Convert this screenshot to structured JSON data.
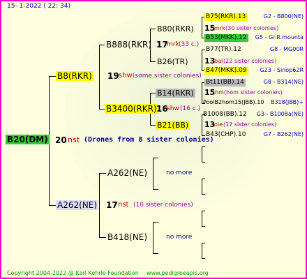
{
  "header": {
    "date": "15-  1-2022 ( 22: 34)"
  },
  "footer": {
    "copyright": "Copyright 2004-2022 @ Karl Kehrle Foundation",
    "site": "www.pedigreeapis.org"
  },
  "colors": {
    "border": "#ff00cc",
    "background": "#ffffe0",
    "yellow_box": "#ffff00",
    "green_box": "#33cc33",
    "gray_box": "#bbbbbb",
    "lavender_box": "#ddddff"
  },
  "root": {
    "label": "B20(DM)",
    "num": "20",
    "code": "nst",
    "note": "(Drones from 8 sister colonies)"
  },
  "gen1": [
    {
      "label": "B8(RKR)",
      "num": "19",
      "code": "shw",
      "note": "(some sister colonies)"
    },
    {
      "label": "A262(NE)",
      "num": "17",
      "code": "nst",
      "note": "(10 sister colonies)"
    }
  ],
  "gen2": [
    {
      "label": "B888(RKR)",
      "num": "17",
      "code": "mrk",
      "note": "(33 c.)"
    },
    {
      "label": "B3400(RKR)",
      "num": "16",
      "code": "shw",
      "note": "(16 c.)"
    },
    {
      "label": "A262(NE)",
      "note": "no more"
    },
    {
      "label": "B418(NE)",
      "note": "no more"
    }
  ],
  "gen3": [
    {
      "label": "B80(RKR)",
      "num": "15",
      "code": "mrk",
      "note": "(30 sister colonies)"
    },
    {
      "label": "B26(TR)",
      "num": "13",
      "code": "bal",
      "note": "(22 sister colonies)"
    },
    {
      "label": "B14(RKR)",
      "num": "15",
      "code": "hm",
      "note": "(hom sister colonies)"
    },
    {
      "label": "B21(BB)",
      "num": "13",
      "code": "oie",
      "note": "(12 sister colonies)"
    }
  ],
  "gen4": [
    {
      "label": "B75(RKR).13",
      "right": "G2 - B800(NE)"
    },
    {
      "label": "B53(MKK).12",
      "right": "G5 - Gr.R.mounta"
    },
    {
      "label": "B77(TR).12",
      "right": "G8 - MG00R"
    },
    {
      "label": "B47(MKK).09",
      "right": "G23 - Sinop62R"
    },
    {
      "label": "Bt11(BB).14",
      "right": "G8 - B314(NE)"
    },
    {
      "label": "PoolB2hom15(JBB).10",
      "right": "B318(JBB)+"
    },
    {
      "label": "B1008(BB).12",
      "right": "G3 - B1008a(NE)"
    },
    {
      "label": "B43(CHP).10",
      "right": "G7 - B262(NE)"
    }
  ]
}
